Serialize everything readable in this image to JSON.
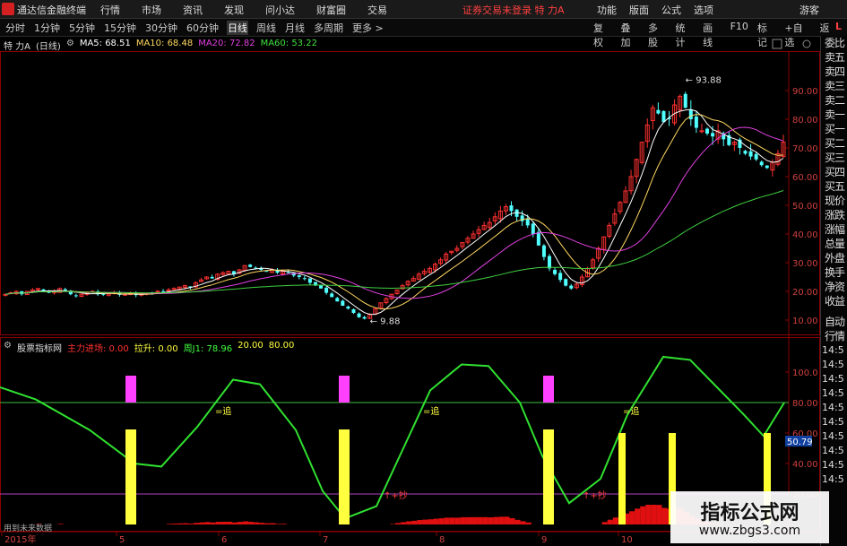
{
  "topbar": {
    "app_title": "通达信金融终端",
    "menus": [
      "行情",
      "市场",
      "资讯",
      "发现",
      "问小达",
      "财富圈",
      "交易"
    ],
    "notice": "证券交易未登录  特 力A",
    "right_menus": [
      "功能",
      "版面",
      "公式",
      "选项"
    ],
    "guest": "游客"
  },
  "periodbar": {
    "periods": [
      "分时",
      "1分钟",
      "5分钟",
      "15分钟",
      "30分钟",
      "60分钟",
      "日线",
      "周线",
      "月线",
      "多周期",
      "更多 >"
    ],
    "selected": "日线",
    "tools": [
      "复权",
      "叠加",
      "多股",
      "统计",
      "画线",
      "F10",
      "标记",
      "+自选",
      "返回"
    ],
    "rl": "L"
  },
  "maline": {
    "stock": "特 力A",
    "period": "(日线)",
    "ma5": "MA5: 68.51",
    "ma10": "MA10: 68.48",
    "ma20": "MA20: 72.82",
    "ma60": "MA60: 53.22"
  },
  "price_axis": [
    "90.00",
    "80.00",
    "70.00",
    "60.00",
    "50.00",
    "40.00",
    "30.00",
    "20.00",
    "10.00"
  ],
  "price_labels": {
    "high": "93.88",
    "low": "9.88"
  },
  "indicator": {
    "name": "股票指标网",
    "main_in": "主力进场: 0.00",
    "lift": "拉升: 0.00",
    "zhou": "周J1: 78.96",
    "v20": "20.00",
    "v80": "80.00",
    "axis": [
      "100.0",
      "80.00",
      "60.00",
      "40.00",
      "20.00"
    ],
    "current": "50.79",
    "zhui": "=追",
    "chao": "↑+抄"
  },
  "date_axis": [
    "2015年",
    "5",
    "6",
    "7",
    "8",
    "9",
    "10"
  ],
  "footer_left": "用到未来数据",
  "right_column": {
    "top": [
      "委比",
      "卖五",
      "卖四",
      "卖三",
      "卖二",
      "卖一",
      "买一",
      "买二",
      "买三",
      "买四",
      "买五",
      "现价",
      "涨跌",
      "涨幅",
      "总量",
      "外盘",
      "换手",
      "净资",
      "收益"
    ],
    "bottom": [
      "自动",
      "行情",
      "14:5",
      "14:5",
      "14:5",
      "14:5",
      "14:5",
      "14:5",
      "14:5",
      "14:5",
      "14:5",
      "14:5"
    ]
  },
  "watermark": {
    "title": "指标公式网",
    "url": "www.zbgs3.com"
  },
  "chart_data": {
    "type": "candlestick",
    "title": "",
    "ylim": [
      5,
      100
    ],
    "highest": 93.88,
    "lowest": 9.88,
    "x_labels": [
      "2015年",
      "5",
      "6",
      "7",
      "8",
      "9",
      "10"
    ],
    "close": [
      19,
      19.5,
      20,
      19,
      20,
      20.5,
      21,
      20,
      19.5,
      20,
      21,
      20,
      19,
      18.5,
      19,
      19.5,
      20,
      19,
      18.8,
      19.2,
      19.5,
      18.8,
      19,
      19.2,
      18.7,
      19,
      19.3,
      19.6,
      20,
      19.8,
      20.5,
      21,
      21.5,
      22,
      21.5,
      23,
      24,
      25,
      24.5,
      26,
      26.5,
      27,
      26,
      27.5,
      29,
      28.5,
      28,
      27.5,
      27,
      27.5,
      26.5,
      27,
      26.5,
      25.5,
      25,
      24.5,
      23,
      22,
      21,
      19.5,
      18,
      16.5,
      15,
      14,
      12.5,
      11,
      10.5,
      12,
      14,
      16,
      17.5,
      19,
      20.5,
      22,
      23.5,
      24.5,
      26,
      27,
      28,
      29.5,
      31,
      33,
      34,
      35,
      37,
      38.5,
      40,
      41.5,
      43,
      44,
      46,
      48,
      49.5,
      48,
      46,
      44.5,
      43,
      40,
      36,
      32,
      28,
      26,
      24,
      22,
      21,
      22.5,
      25,
      28,
      31,
      35,
      39,
      43,
      47,
      51,
      55,
      60,
      66,
      72,
      78,
      84,
      82,
      79,
      80,
      85,
      88,
      84,
      80,
      77,
      76,
      75,
      74,
      76,
      73,
      71,
      72,
      70,
      68,
      67,
      66,
      64,
      63,
      65,
      68,
      72
    ]
  }
}
